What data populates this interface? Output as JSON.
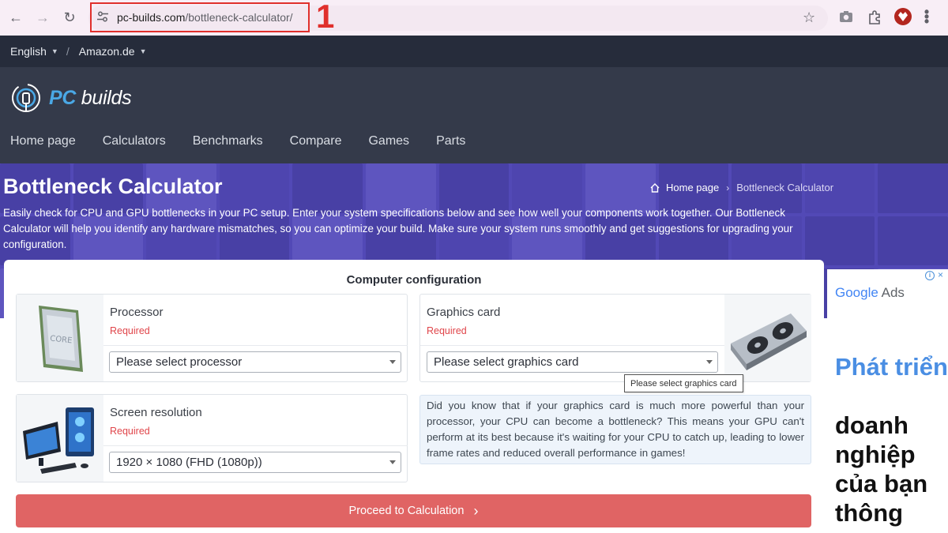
{
  "browser": {
    "url_domain": "pc-builds.com",
    "url_path": "/bottleneck-calculator/",
    "annotation_number": "1"
  },
  "topbar": {
    "language": "English",
    "store": "Amazon.de",
    "separator": "/"
  },
  "header": {
    "logo_pc": "PC",
    "logo_builds": "builds",
    "nav": [
      "Home page",
      "Calculators",
      "Benchmarks",
      "Compare",
      "Games",
      "Parts"
    ]
  },
  "hero": {
    "title": "Bottleneck Calculator",
    "breadcrumb_home": "Home page",
    "breadcrumb_current": "Bottleneck Calculator",
    "description": "Easily check for CPU and GPU bottlenecks in your PC setup. Enter your system specifications below and see how well your components work together. Our Bottleneck Calculator will help you identify any hardware mismatches, so you can optimize your build. Make sure your system runs smoothly and get suggestions for upgrading your configuration."
  },
  "config": {
    "title": "Computer configuration",
    "processor": {
      "label": "Processor",
      "required": "Required",
      "placeholder": "Please select processor"
    },
    "graphics": {
      "label": "Graphics card",
      "required": "Required",
      "placeholder": "Please select graphics card",
      "tooltip": "Please select graphics card"
    },
    "resolution": {
      "label": "Screen resolution",
      "required": "Required",
      "value": "1920 × 1080 (FHD (1080p))"
    },
    "info": "Did you know that if your graphics card is much more powerful than your processor, your CPU can become a bottleneck? This means your GPU can't perform at its best because it's waiting for your CPU to catch up, leading to lower frame rates and reduced overall performance in games!",
    "proceed_label": "Proceed to Calculation"
  },
  "ad": {
    "brand_google": "Google",
    "brand_ads": "Ads",
    "headline_blue": "Phát triển",
    "headline_dark": "doanh nghiệp của bạn thông"
  },
  "colors": {
    "accent_red": "#e06464",
    "hero_purple": "#5249b6",
    "header_dark": "#343a4a",
    "logo_blue": "#4aa8e6"
  }
}
